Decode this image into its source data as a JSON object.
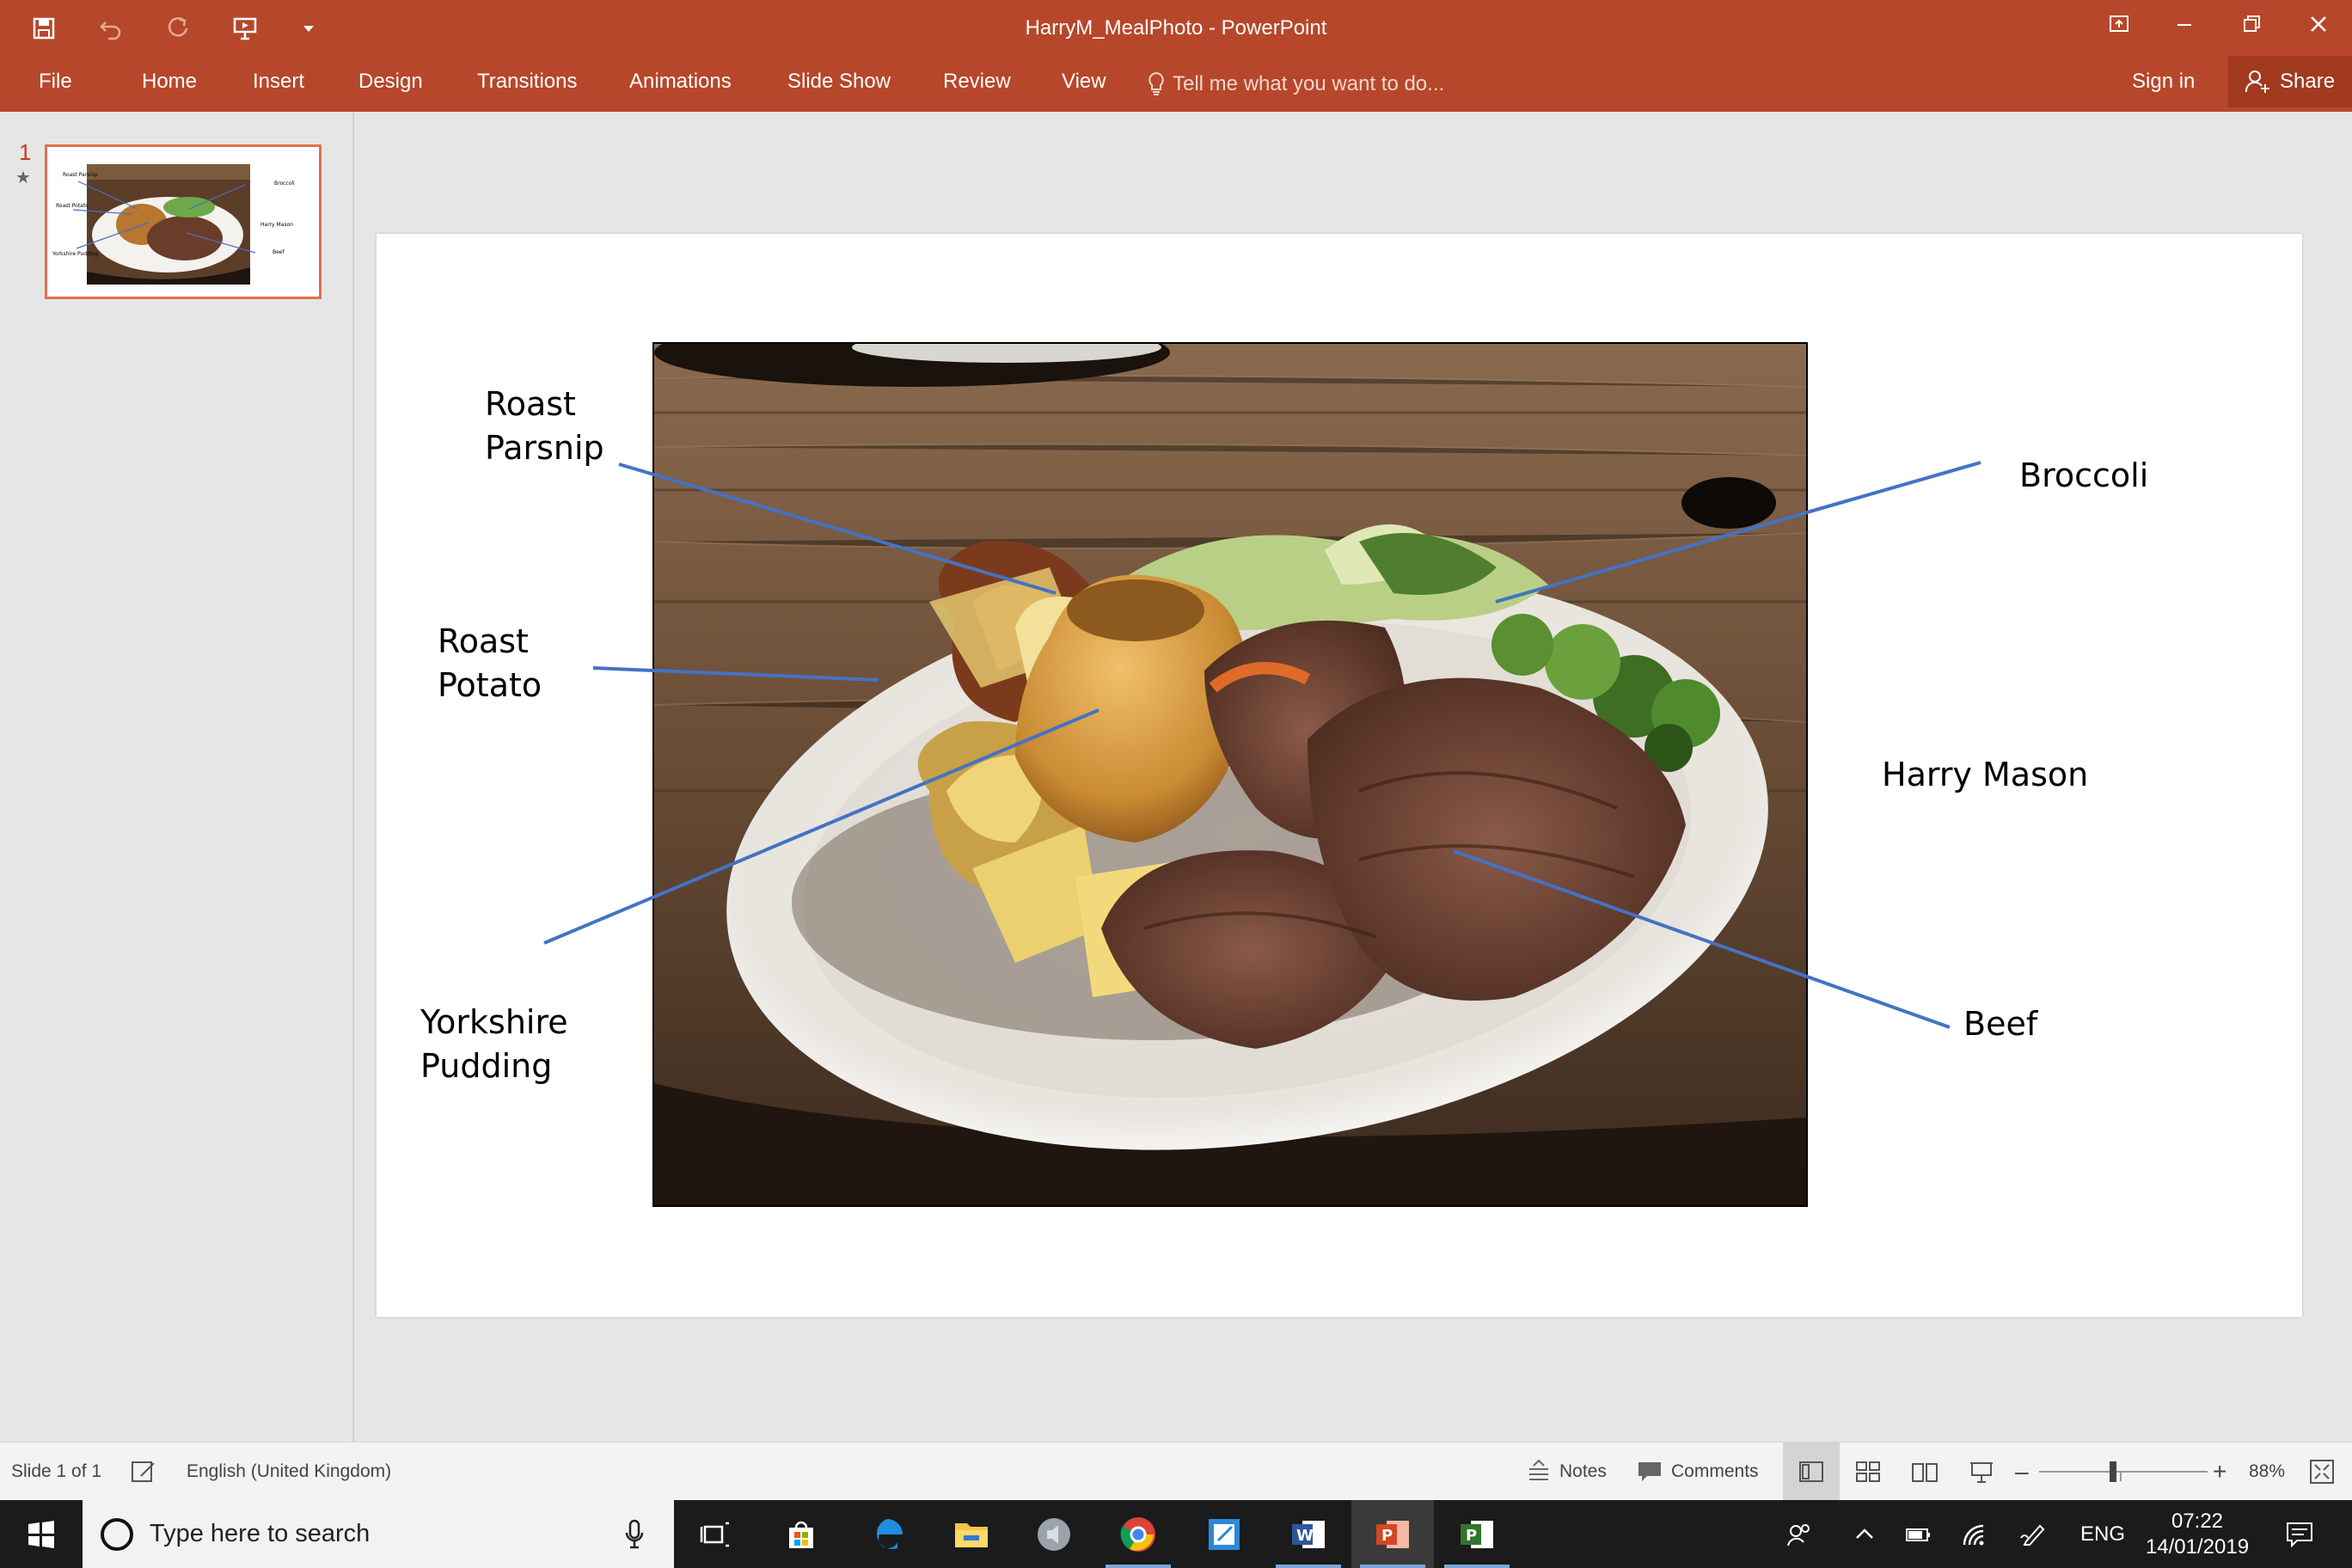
{
  "app": {
    "document_title": "HarryM_MealPhoto - PowerPoint",
    "tell_me_placeholder": "Tell me what you want to do...",
    "sign_in": "Sign in",
    "share": "Share"
  },
  "tabs": [
    {
      "label": "File"
    },
    {
      "label": "Home"
    },
    {
      "label": "Insert"
    },
    {
      "label": "Design"
    },
    {
      "label": "Transitions"
    },
    {
      "label": "Animations"
    },
    {
      "label": "Slide Show"
    },
    {
      "label": "Review"
    },
    {
      "label": "View"
    }
  ],
  "thumbnails": [
    {
      "number": "1",
      "icon": "animation-star-icon",
      "labels": [
        "Roast Parsnip",
        "Broccoli",
        "Roast Potato",
        "Harry Mason",
        "Yorkshire Pudding",
        "Beef"
      ]
    }
  ],
  "slide": {
    "labels": {
      "roast_parsnip": "Roast\nParsnip",
      "roast_potato": "Roast\nPotato",
      "yorkshire_pudding": "Yorkshire\nPudding",
      "broccoli": "Broccoli",
      "harry_mason": "Harry Mason",
      "beef": "Beef"
    },
    "line_color": "#4472c4",
    "photo": "roast dinner plate on wooden table"
  },
  "status": {
    "slide_counter": "Slide 1 of 1",
    "language": "English (United Kingdom)",
    "notes": "Notes",
    "comments": "Comments",
    "zoom": "88%"
  },
  "taskbar": {
    "search_placeholder": "Type here to search",
    "apps": [
      "task-view-icon",
      "store-icon",
      "edge-icon",
      "file-explorer-icon",
      "speaker-app-icon",
      "chrome-icon",
      "notepad-app-icon",
      "word-icon",
      "powerpoint-icon",
      "project-icon"
    ],
    "language": "ENG",
    "time": "07:22",
    "date": "14/01/2019"
  },
  "colors": {
    "accent": "#b7472a",
    "share_bg": "#a1391f",
    "thumb_border": "#e0714f"
  }
}
